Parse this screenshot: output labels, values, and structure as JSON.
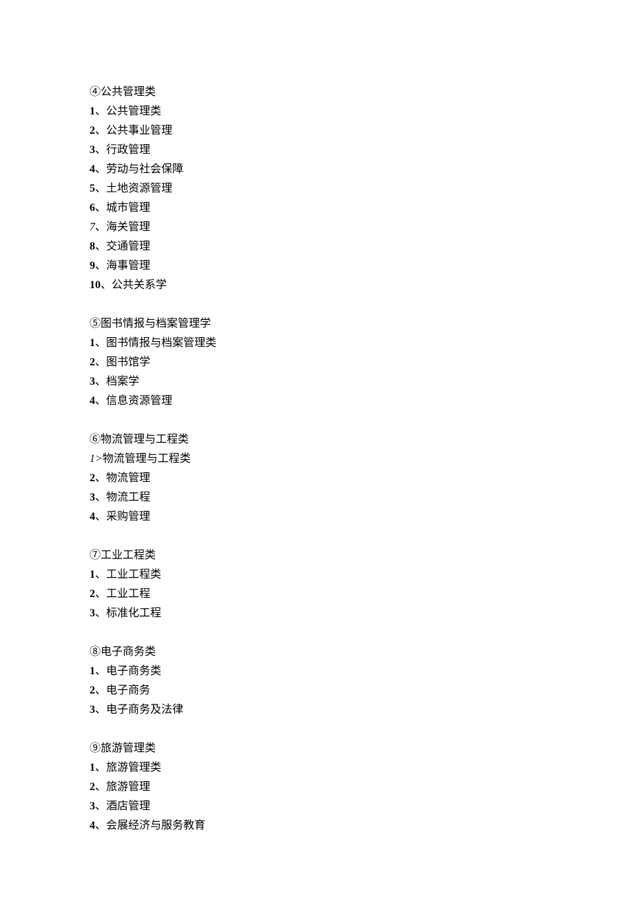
{
  "sections": [
    {
      "header": "④公共管理类",
      "items": [
        {
          "num": "1",
          "sep": "、",
          "text": "公共管理类",
          "numClass": "num"
        },
        {
          "num": "2",
          "sep": "、",
          "text": "公共事业管理",
          "numClass": "num"
        },
        {
          "num": "3",
          "sep": "、",
          "text": "行政管理",
          "numClass": "num"
        },
        {
          "num": "4",
          "sep": "、",
          "text": "劳动与社会保障",
          "numClass": "num"
        },
        {
          "num": "5",
          "sep": "、",
          "text": "土地资源管理",
          "numClass": "num"
        },
        {
          "num": "6",
          "sep": "、",
          "text": "城市管理",
          "numClass": "num"
        },
        {
          "num": "7",
          "sep": "、",
          "text": "海关管理",
          "numClass": "italic-num"
        },
        {
          "num": "8",
          "sep": "、",
          "text": "交通管理",
          "numClass": "num"
        },
        {
          "num": "9",
          "sep": "、",
          "text": "海事管理",
          "numClass": "num"
        },
        {
          "num": "10",
          "sep": "、",
          "text": "公共关系学",
          "numClass": "num"
        }
      ]
    },
    {
      "header": "⑤图书情报与档案管理学",
      "items": [
        {
          "num": "1",
          "sep": "、",
          "text": "图书情报与档案管理类",
          "numClass": "num"
        },
        {
          "num": "2",
          "sep": "、",
          "text": "图书馆学",
          "numClass": "num"
        },
        {
          "num": "3",
          "sep": "、",
          "text": "档案学",
          "numClass": "num"
        },
        {
          "num": "4",
          "sep": "、",
          "text": "信息资源管理",
          "numClass": "num"
        }
      ]
    },
    {
      "header": "⑥物流管理与工程类",
      "items": [
        {
          "num": "1>",
          "sep": "",
          "text": "物流管理与工程类",
          "numClass": "italic-num"
        },
        {
          "num": "2",
          "sep": "、",
          "text": "物流管理",
          "numClass": "num"
        },
        {
          "num": "3",
          "sep": "、",
          "text": "物流工程",
          "numClass": "num"
        },
        {
          "num": "4",
          "sep": "、",
          "text": "采购管理",
          "numClass": "num"
        }
      ]
    },
    {
      "header": "⑦工业工程类",
      "items": [
        {
          "num": "1",
          "sep": "、",
          "text": "工业工程类",
          "numClass": "num"
        },
        {
          "num": "2",
          "sep": "、",
          "text": "工业工程",
          "numClass": "num"
        },
        {
          "num": "3",
          "sep": "、",
          "text": "标准化工程",
          "numClass": "num"
        }
      ]
    },
    {
      "header": "⑧电子商务类",
      "items": [
        {
          "num": "1",
          "sep": "、",
          "text": "电子商务类",
          "numClass": "num"
        },
        {
          "num": "2",
          "sep": "、",
          "text": "电子商务",
          "numClass": "num"
        },
        {
          "num": "3",
          "sep": "、",
          "text": "电子商务及法律",
          "numClass": "num"
        }
      ]
    },
    {
      "header": "⑨旅游管理类",
      "items": [
        {
          "num": "1",
          "sep": "、",
          "text": "旅游管理类",
          "numClass": "num"
        },
        {
          "num": "2",
          "sep": "、",
          "text": "旅游管理",
          "numClass": "num"
        },
        {
          "num": "3",
          "sep": "、",
          "text": "酒店管理",
          "numClass": "num"
        },
        {
          "num": "4",
          "sep": "、",
          "text": "会展经济与服务教育",
          "numClass": "num"
        }
      ]
    }
  ]
}
